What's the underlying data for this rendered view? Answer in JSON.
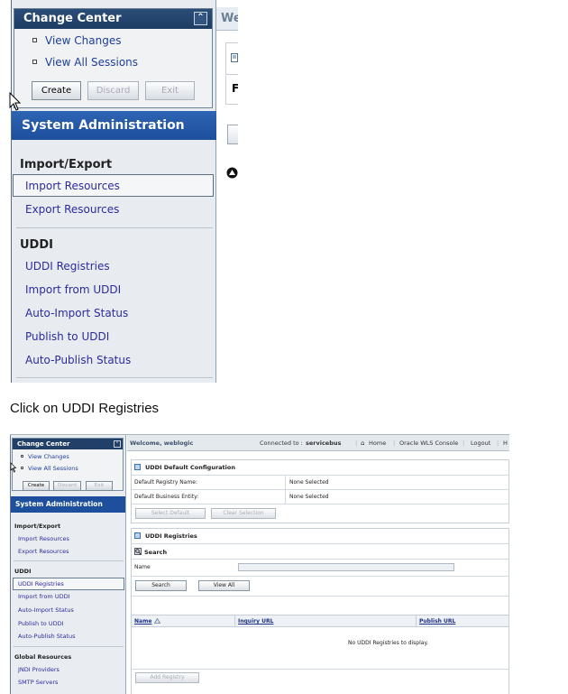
{
  "top_panel": {
    "change_center": {
      "title": "Change Center",
      "collapse_icon": "chevron-up-icon",
      "links": [
        "View Changes",
        "View All Sessions"
      ],
      "buttons": {
        "create": "Create",
        "discard": "Discard",
        "exit": "Exit"
      }
    },
    "welcome_fragment": "We",
    "system_admin_title": "System Administration",
    "import_export": {
      "title": "Import/Export",
      "items": [
        "Import Resources",
        "Export Resources"
      ]
    },
    "uddi": {
      "title": "UDDI",
      "items": [
        "UDDI Registries",
        "Import from UDDI",
        "Auto-Import Status",
        "Publish to UDDI",
        "Auto-Publish Status"
      ]
    },
    "main_fragment_letter": "F"
  },
  "caption": "Click on UDDI Registries",
  "bottom_panel": {
    "change_center": {
      "title": "Change Center",
      "links": [
        "View Changes",
        "View All Sessions"
      ],
      "buttons": {
        "create": "Create",
        "discard": "Discard",
        "exit": "Exit"
      }
    },
    "system_admin_title": "System Administration",
    "import_export": {
      "title": "Import/Export",
      "items": [
        "Import Resources",
        "Export Resources"
      ]
    },
    "uddi": {
      "title": "UDDI",
      "items": [
        "UDDI Registries",
        "Import from UDDI",
        "Auto-Import Status",
        "Publish to UDDI",
        "Auto-Publish Status"
      ]
    },
    "global_resources": {
      "title": "Global Resources",
      "items": [
        "JNDI Providers",
        "SMTP Servers"
      ]
    },
    "topbar": {
      "welcome": "Welcome, weblogic",
      "connected_label": "Connected to :",
      "connected_value": "servicebus",
      "home": "Home",
      "wls_console": "Oracle WLS Console",
      "logout": "Logout",
      "help_fragment": "H"
    },
    "uddi_default_config": {
      "title": "UDDI Default Configuration",
      "registry_name_label": "Default Registry Name:",
      "registry_name_value": "None Selected",
      "business_entity_label": "Default Business Entity:",
      "business_entity_value": "None Selected",
      "select_default": "Select Default",
      "clear_selection": "Clear Selection"
    },
    "uddi_registries": {
      "title": "UDDI Registries",
      "search_title": "Search",
      "name_label": "Name",
      "search_button": "Search",
      "view_all_button": "View All",
      "columns": [
        "Name",
        "Inquiry URL",
        "Publish URL"
      ],
      "empty_message": "No UDDI Registries to display.",
      "add_registry": "Add Registry"
    }
  }
}
